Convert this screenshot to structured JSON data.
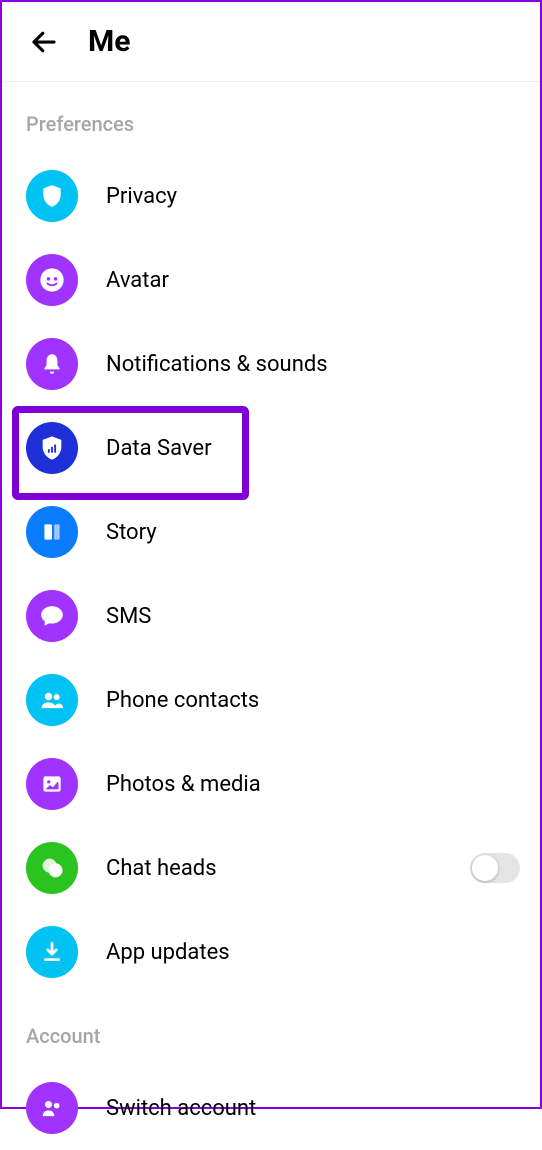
{
  "header": {
    "title": "Me"
  },
  "sections": [
    {
      "name": "Preferences",
      "items": [
        {
          "label": "Privacy"
        },
        {
          "label": "Avatar"
        },
        {
          "label": "Notifications & sounds"
        },
        {
          "label": "Data Saver"
        },
        {
          "label": "Story"
        },
        {
          "label": "SMS"
        },
        {
          "label": "Phone contacts"
        },
        {
          "label": "Photos & media"
        },
        {
          "label": "Chat heads",
          "toggle": false
        },
        {
          "label": "App updates"
        }
      ]
    },
    {
      "name": "Account",
      "items": [
        {
          "label": "Switch account"
        }
      ]
    }
  ],
  "colors": {
    "cyan": "#00c2f3",
    "purple": "#a033ff",
    "blue": "#0a7cff",
    "darkblue": "#2030d8",
    "green": "#2ac420",
    "highlight": "#7e00d6"
  }
}
